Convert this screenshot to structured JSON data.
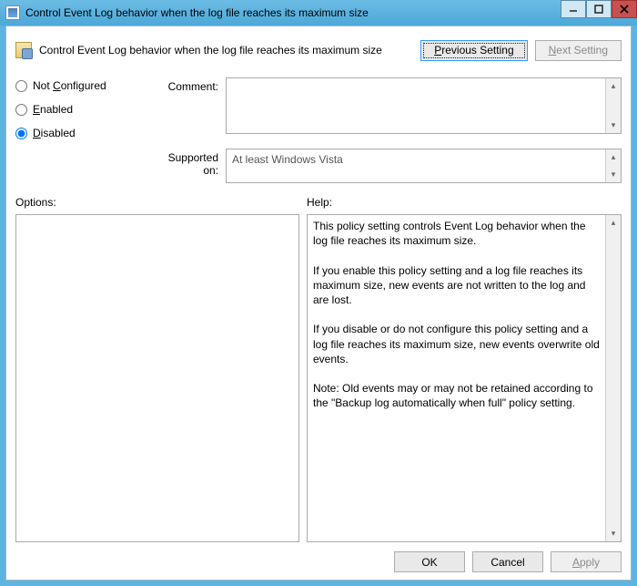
{
  "window": {
    "title": "Control Event Log behavior when the log file reaches its maximum size"
  },
  "header": {
    "policy_title": "Control Event Log behavior when the log file reaches its maximum size",
    "prev_setting": "Previous Setting",
    "next_setting": "Next Setting"
  },
  "state": {
    "not_configured": "Not Configured",
    "enabled": "Enabled",
    "disabled": "Disabled",
    "selected": "disabled"
  },
  "labels": {
    "comment": "Comment:",
    "supported_on": "Supported on:",
    "options": "Options:",
    "help": "Help:"
  },
  "fields": {
    "comment_value": "",
    "supported_value": "At least Windows Vista"
  },
  "help_text": "This policy setting controls Event Log behavior when the log file reaches its maximum size.\n\nIf you enable this policy setting and a log file reaches its maximum size, new events are not written to the log and are lost.\n\nIf you disable or do not configure this policy setting and a log file reaches its maximum size, new events overwrite old events.\n\nNote: Old events may or may not be retained according to the \"Backup log automatically when full\" policy setting.",
  "buttons": {
    "ok": "OK",
    "cancel": "Cancel",
    "apply": "Apply"
  }
}
